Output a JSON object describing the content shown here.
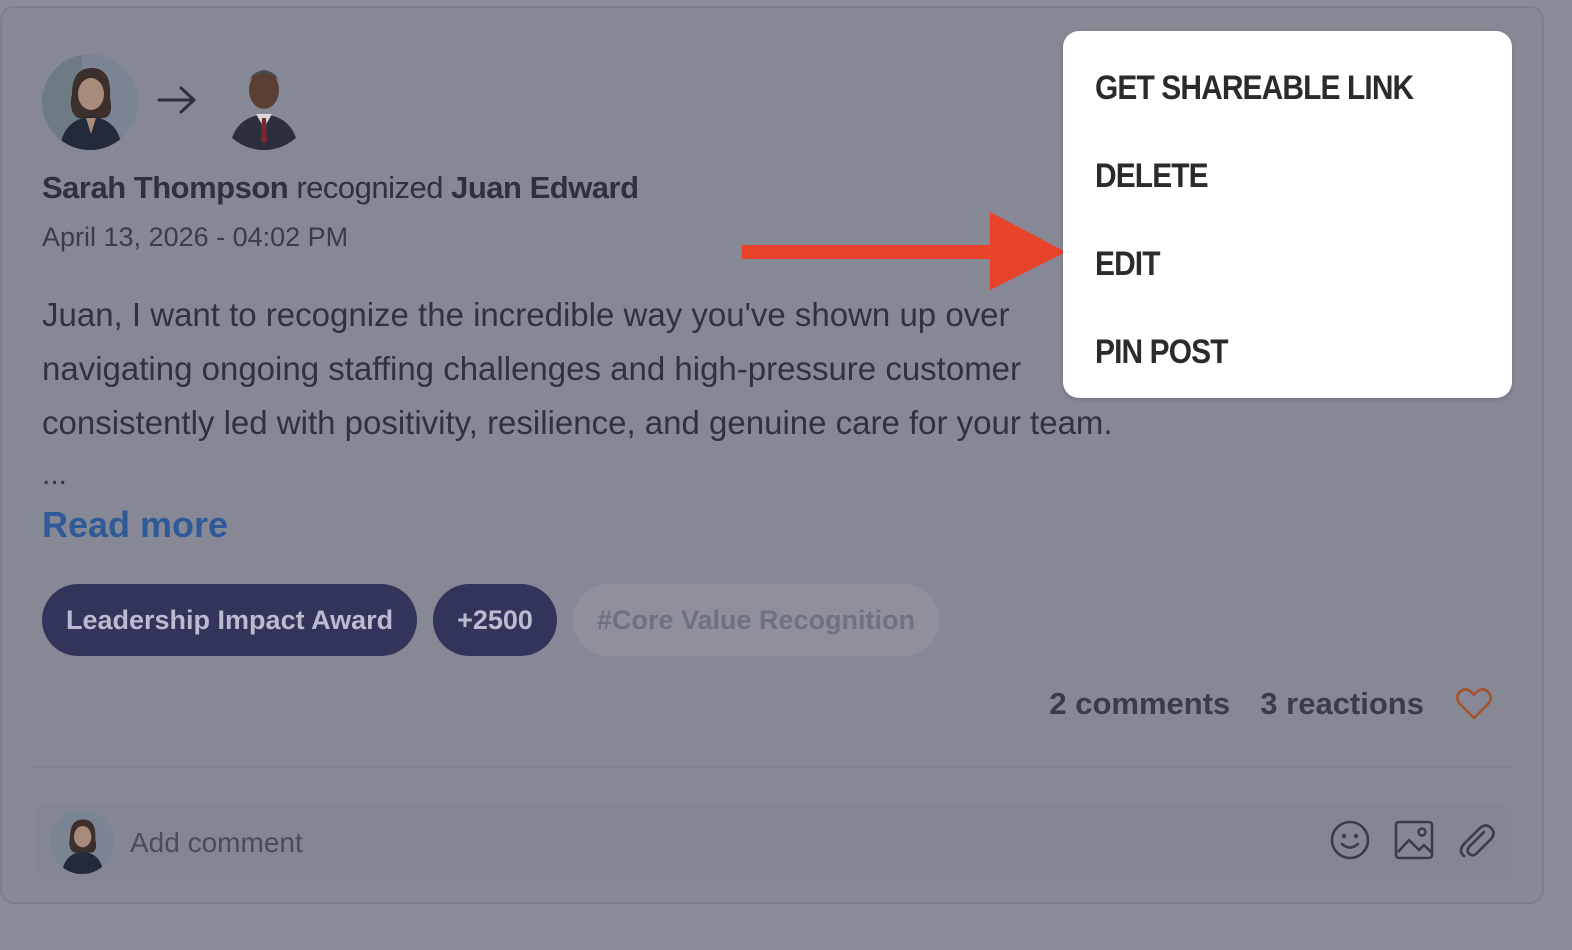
{
  "post": {
    "sender": "Sarah Thompson",
    "verb": "recognized",
    "recipient": "Juan Edward",
    "date": "April 13, 2026 - 04:02 PM",
    "body": "Juan, I want to recognize the incredible way you've shown up over navigating ongoing staffing challenges and high-pressure customer consistently led with positivity, resilience, and genuine care for your team.",
    "body_lines": [
      "Juan, I want to recognize the incredible way you've shown up over",
      "navigating ongoing staffing challenges and high-pressure customer",
      "consistently led with positivity, resilience, and genuine care for your team."
    ],
    "ellipsis": "...",
    "read_more": "Read more"
  },
  "tags": {
    "award": "Leadership Impact Award",
    "points": "+2500",
    "hashtag": "#Core Value Recognition"
  },
  "stats": {
    "comments": "2 comments",
    "reactions": "3 reactions"
  },
  "comment_bar": {
    "placeholder": "Add comment"
  },
  "menu": {
    "items": [
      "GET SHAREABLE LINK",
      "DELETE",
      "EDIT",
      "PIN POST"
    ]
  },
  "icons": {
    "arrow_between_avatars": "arrow-right-icon",
    "reaction": "heart-icon",
    "emoji": "emoji-icon",
    "image": "image-icon",
    "attach": "paperclip-icon"
  },
  "colors": {
    "annotation_arrow": "#e8442c",
    "tag_dark": "#33345a",
    "link": "#2f5a98",
    "heart": "#a4532e"
  }
}
